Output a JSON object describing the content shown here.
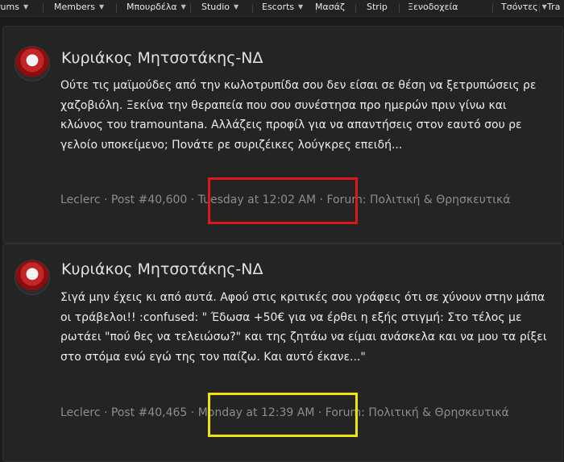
{
  "nav": {
    "items": [
      "rums",
      "Members",
      "Μπουρδέλα",
      "Studio",
      "Escorts",
      "Μασάζ",
      "Strip",
      "Ξενοδοχεία",
      "Τσόντες",
      "Tra"
    ]
  },
  "posts": [
    {
      "author": "Κυριάκος Μητσοτάκης-ΝΔ",
      "text": "Ούτε τις μαϊμούδες από την κωλοτρυπίδα σου δεν είσαι σε θέση να ξετρυπώσεις ρε χαζοβιόλη. Ξεκίνα την θεραπεία που σου συνέστησα προ ημερών πριν γίνω και κλώνος του tramountana. Αλλάζεις προφίλ για να απαντήσεις στον εαυτό σου ρε γελοίο υποκείμενο; Πονάτε ρε συριζέικες λούγκρες επειδή...",
      "user": "Leclerc",
      "sep1": " · ",
      "post_no": "Post #40,600",
      "sep2": " · ",
      "time": "Tuesday at 12:02 AM",
      "sep3": " · ",
      "forum": "Forum: Πολιτική & Θρησκευτικά",
      "highlight_color": "#e0161d"
    },
    {
      "author": "Κυριάκος Μητσοτάκης-ΝΔ",
      "text": "Σιγά μην έχεις κι από αυτά. Αφού στις κριτικές σου γράφεις ότι σε χύνουν στην μάπα οι τράβελοι!! :confused: \" Έδωσα +50€ για να έρθει η εξής στιγμή: Στο τέλος με ρωτάει \"πού θες να τελειώσω?\" και της ζητάω να είμαι ανάσκελα και να μου τα ρίξει στο στόμα ενώ εγώ της τον παίζω. Και αυτό έκανε...\"",
      "user": "Leclerc",
      "sep1": " · ",
      "post_no": "Post #40,465",
      "sep2": " · ",
      "time": "Monday at 12:39 AM",
      "sep3": " · ",
      "forum": "Forum: Πολιτική & Θρησκευτικά",
      "highlight_color": "#f2e30f"
    }
  ]
}
